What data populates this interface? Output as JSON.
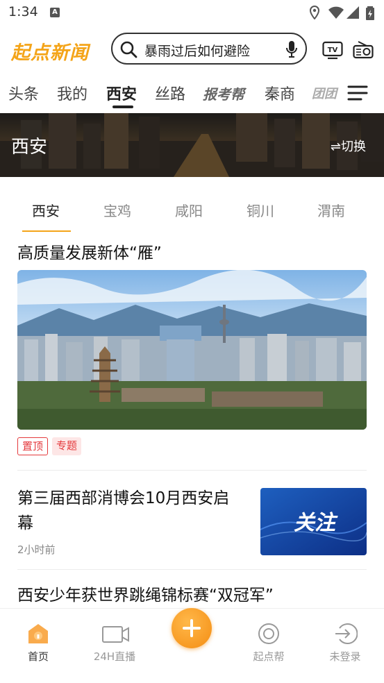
{
  "status_bar": {
    "time": "1:34",
    "icons": [
      "a-notification-icon",
      "location-icon",
      "wifi-icon",
      "signal-icon",
      "battery-charging-icon"
    ]
  },
  "header": {
    "logo_text": "起点新闻",
    "search_placeholder": "暴雨过后如何避险",
    "icons": [
      "search-icon",
      "mic-icon",
      "tv-icon",
      "radio-icon"
    ],
    "accent_color": "#f4a418"
  },
  "channel_tabs": {
    "items": [
      {
        "label": "头条"
      },
      {
        "label": "我的"
      },
      {
        "label": "西安",
        "active": true
      },
      {
        "label": "丝路"
      },
      {
        "label": "报考帮"
      },
      {
        "label": "秦商"
      },
      {
        "label": "团团"
      }
    ]
  },
  "banner": {
    "title": "西安",
    "switch_label": "⇌切换"
  },
  "city_tabs": {
    "items": [
      {
        "label": "西安",
        "active": true
      },
      {
        "label": "宝鸡"
      },
      {
        "label": "咸阳"
      },
      {
        "label": "铜川"
      },
      {
        "label": "渭南"
      }
    ],
    "active_color": "#f4a418"
  },
  "feed": {
    "featured": {
      "title": "高质量发展新体“雁”",
      "tags": [
        "置顶",
        "专题"
      ]
    },
    "items": [
      {
        "title_line1": "第三届西部消博会10月西安启",
        "title_line2": "幕",
        "time_ago": "2小时前",
        "thumb_text": "关注"
      },
      {
        "title_line1": "西安少年获世界跳绳锦标赛“双冠军”"
      }
    ]
  },
  "bottom_nav": {
    "items": [
      {
        "label": "首页",
        "icon": "home-icon",
        "active": true
      },
      {
        "label": "24H直播",
        "icon": "video-icon"
      },
      {
        "label": "起点帮",
        "icon": "help-circle-icon"
      },
      {
        "label": "未登录",
        "icon": "login-icon"
      }
    ],
    "fab_icon": "plus-icon"
  }
}
